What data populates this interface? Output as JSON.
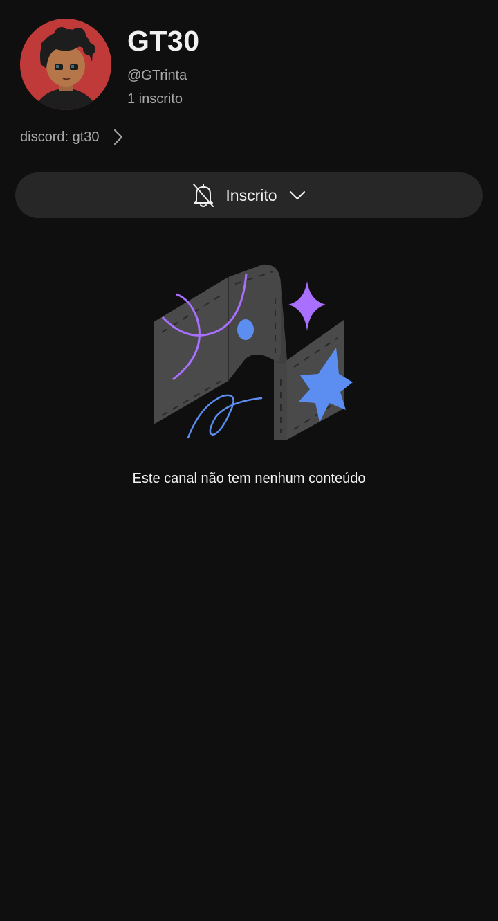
{
  "channel": {
    "name": "GT30",
    "handle": "@GTrinta",
    "subscribers": "1 inscrito",
    "avatar_icon": "avatar-icon",
    "avatar_color": "#c13a3a"
  },
  "links": {
    "label": "discord: gt30",
    "icon": "chevron-right-icon"
  },
  "subscribe_button": {
    "label": "Inscrito",
    "bell_icon": "bell-off-icon",
    "dropdown_icon": "chevron-down-icon"
  },
  "empty_state": {
    "illustration": "empty-channel-illustration",
    "message": "Este canal não tem nenhum conteúdo"
  },
  "colors": {
    "background": "#0f0f0f",
    "button_bg": "#272727",
    "text_primary": "#f1f1f1",
    "text_secondary": "#aaaaaa",
    "accent_purple": "#a970ff",
    "accent_blue": "#5b8ef0"
  }
}
